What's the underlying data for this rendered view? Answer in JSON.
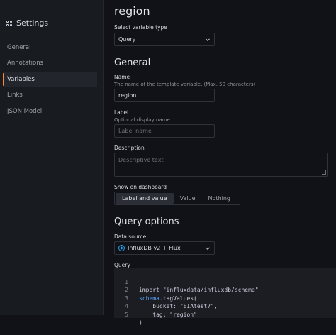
{
  "sidebar": {
    "title": "Settings",
    "items": [
      {
        "label": "General"
      },
      {
        "label": "Annotations"
      },
      {
        "label": "Variables"
      },
      {
        "label": "Links"
      },
      {
        "label": "JSON Model"
      }
    ],
    "active_index": 2
  },
  "main": {
    "title": "region",
    "type_label": "Select variable type",
    "type_value": "Query",
    "general_heading": "General",
    "name_label": "Name",
    "name_desc": "The name of the template variable. (Max. 50 characters)",
    "name_value": "region",
    "label_label": "Label",
    "label_desc": "Optional display name",
    "label_placeholder": "Label name",
    "description_label": "Description",
    "description_placeholder": "Descriptive text",
    "show_label": "Show on dashboard",
    "show_options": [
      "Label and value",
      "Value",
      "Nothing"
    ],
    "show_selected": "Label and value",
    "query_heading": "Query options",
    "datasource_label": "Data source",
    "datasource_value": "InfluxDB v2 + Flux",
    "query_label": "Query",
    "code_lines": [
      {
        "n": "1",
        "text": "import \"influxdata/influxdb/schema\""
      },
      {
        "n": "2",
        "text": "schema.tagValues("
      },
      {
        "n": "3",
        "text": "    bucket: \"EIAtest7\","
      },
      {
        "n": "4",
        "text": "    tag: \"region\""
      },
      {
        "n": "5",
        "text": ")"
      }
    ]
  },
  "colors": {
    "accent": "#ff8833",
    "background": "#111217",
    "sidebar": "#181b1f",
    "keyword": "#5aa4ff"
  },
  "icons": [
    "settings-grid-icon",
    "chevron-down-icon",
    "influxdb-icon",
    "resize-handle-icon"
  ]
}
